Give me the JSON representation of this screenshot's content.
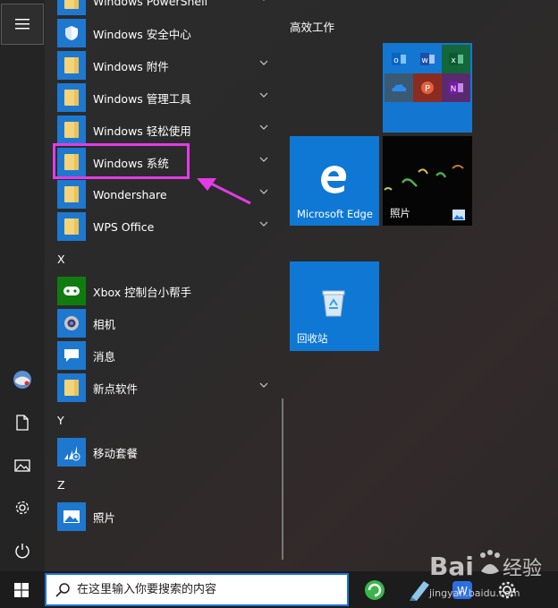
{
  "start_menu": {
    "apps": [
      {
        "label": "Windows PowerShell",
        "type": "folder",
        "chevron": true
      },
      {
        "label": "Windows 安全中心",
        "type": "app",
        "icon": "shield-icon"
      },
      {
        "label": "Windows 附件",
        "type": "folder",
        "chevron": true
      },
      {
        "label": "Windows 管理工具",
        "type": "folder",
        "chevron": true
      },
      {
        "label": "Windows 轻松使用",
        "type": "folder",
        "chevron": true
      },
      {
        "label": "Windows 系统",
        "type": "folder",
        "chevron": true,
        "highlighted": true
      },
      {
        "label": "Wondershare",
        "type": "folder",
        "chevron": true
      },
      {
        "label": "WPS Office",
        "type": "folder",
        "chevron": true
      },
      {
        "label": "Xbox 控制台小帮手",
        "type": "app",
        "icon": "xbox-icon"
      },
      {
        "label": "相机",
        "type": "app",
        "icon": "camera-icon"
      },
      {
        "label": "消息",
        "type": "app",
        "icon": "message-icon"
      },
      {
        "label": "新点软件",
        "type": "folder",
        "chevron": true
      },
      {
        "label": "移动套餐",
        "type": "app",
        "icon": "mobile-plans-icon"
      },
      {
        "label": "照片",
        "type": "app",
        "icon": "photos-icon"
      }
    ],
    "section_letters": [
      "X",
      "Y",
      "Z"
    ]
  },
  "tiles": {
    "group_title": "高效工作",
    "edge_label": "Microsoft Edge",
    "photos_label": "照片",
    "recycle_label": "回收站"
  },
  "taskbar": {
    "search_placeholder": "在这里输入你要搜索的内容"
  },
  "colors": {
    "accent": "#0f78d4",
    "highlight": "#e23ce6",
    "folder": "#f4d47a"
  }
}
